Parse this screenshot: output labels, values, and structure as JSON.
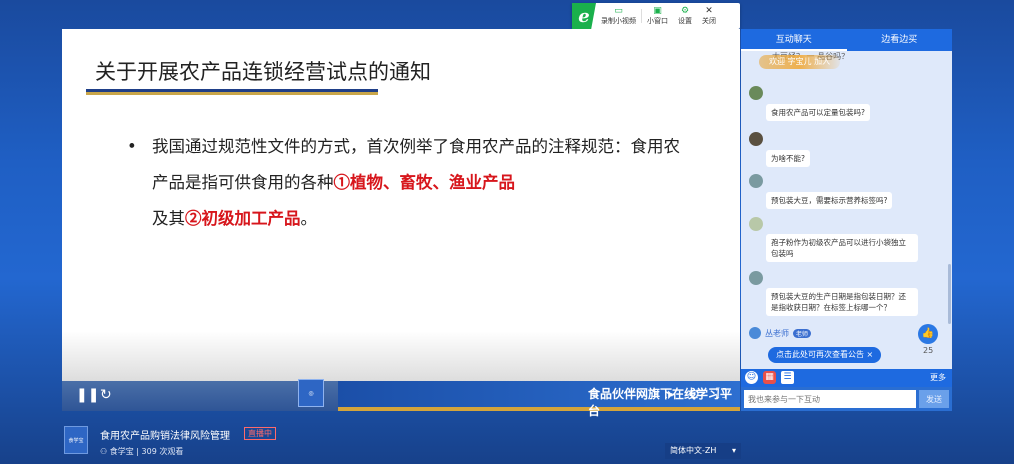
{
  "toolbar": {
    "brand": "e",
    "record_label": "录制小视频",
    "mini_window_label": "小窗口",
    "settings_label": "设置",
    "close_label": "关闭"
  },
  "slide": {
    "title": "关于开展农产品连锁经营试点的通知",
    "bullet_part1": "我国通过规范性文件的方式，首次例举了食用农产品的注释规范：食用农产品是指可供食用的各种",
    "bullet_red1": "①植物、畜牧、渔业产品",
    "bullet_part2": "及其",
    "bullet_red2": "②初级加工产品",
    "bullet_part3": "。"
  },
  "controls": {
    "ticker_text": "食品伙伴网旗下在线学习平台"
  },
  "chat": {
    "tabs": [
      "互动聊天",
      "边看边买"
    ],
    "welcome": "欢迎 字宝儿 加入",
    "faded_text": "大豆经？ 一 品谷吗？",
    "messages": [
      "食用农产品可以定量包装吗?",
      "为啥不能?",
      "预包装大豆，需要标示营养标签吗?",
      "孢子粉作为初级农产品可以进行小袋独立包装吗",
      "预包装大豆的生产日期是指包装日期？还是指收获日期？在标签上标哪一个？"
    ],
    "teacher_name": "丛老师",
    "teacher_badge": "老师",
    "notice": "点击此处可再次查看公告 ×",
    "like_count": "25",
    "more_label": "更多",
    "input_placeholder": "我也来参与一下互动",
    "send_label": "发送"
  },
  "footer": {
    "logo_text": "食学宝",
    "course_title": "食用农产品购销法律风险管理",
    "live_badge": "直播中",
    "host": "食学宝",
    "views": "309 次观看",
    "language": "简体中文-ZH"
  }
}
